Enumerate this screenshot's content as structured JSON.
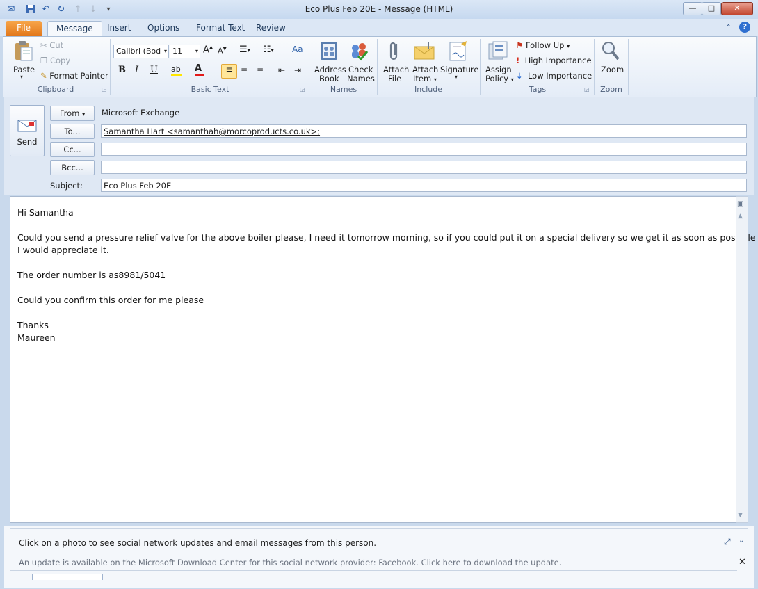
{
  "window": {
    "title": "Eco Plus Feb 20E  -  Message (HTML)",
    "controls": {
      "minimize": "—",
      "maximize": "□",
      "close": "✕"
    }
  },
  "tabs": [
    {
      "label": "File"
    },
    {
      "label": "Message"
    },
    {
      "label": "Insert"
    },
    {
      "label": "Options"
    },
    {
      "label": "Format Text"
    },
    {
      "label": "Review"
    }
  ],
  "ribbon": {
    "clipboard": {
      "paste": "Paste",
      "cut": "Cut",
      "copy": "Copy",
      "format_painter": "Format Painter",
      "label": "Clipboard"
    },
    "basic_text": {
      "font": "Calibri (Bod",
      "size": "11",
      "bold": "B",
      "italic": "I",
      "underline": "U",
      "label": "Basic Text"
    },
    "names": {
      "address_book_1": "Address",
      "address_book_2": "Book",
      "check_names_1": "Check",
      "check_names_2": "Names",
      "label": "Names"
    },
    "include": {
      "attach_file_1": "Attach",
      "attach_file_2": "File",
      "attach_item_1": "Attach",
      "attach_item_2": "Item",
      "signature": "Signature",
      "label": "Include"
    },
    "tags": {
      "assign_policy_1": "Assign",
      "assign_policy_2": "Policy",
      "follow_up": "Follow Up",
      "high_importance": "High Importance",
      "low_importance": "Low Importance",
      "label": "Tags"
    },
    "zoom": {
      "zoom": "Zoom",
      "label": "Zoom"
    }
  },
  "header": {
    "send": "Send",
    "from_button": "From",
    "from_value": "Microsoft Exchange",
    "to_button": "To...",
    "to_value": "Samantha Hart <samanthah@morcoproducts.co.uk>;",
    "cc_button": "Cc...",
    "cc_value": "",
    "bcc_button": "Bcc...",
    "bcc_value": "",
    "subject_label": "Subject:",
    "subject_value": "Eco Plus Feb 20E"
  },
  "body": {
    "lines": [
      "Hi Samantha",
      "Could you send a pressure relief valve for the above boiler please, I need it tomorrow morning, so if you could put it on a special delivery so we get it as soon as possible",
      "I would appreciate it.",
      "The order number is as8981/5041",
      "Could you confirm this order for me please",
      "Thanks",
      "Maureen"
    ]
  },
  "social": {
    "prompt": "Click on a photo to see social network updates and email messages from this person.",
    "update_notice": "An update is available on the Microsoft Download Center for this social network provider: Facebook. Click here to download the update."
  }
}
